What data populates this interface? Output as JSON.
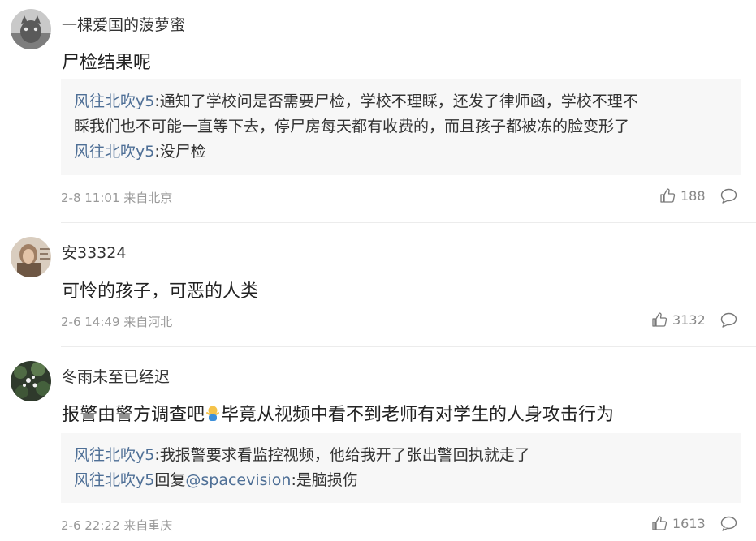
{
  "comments": [
    {
      "username": "一棵爱国的菠萝蜜",
      "content": "尸检结果呢",
      "replies": [
        {
          "user": "风往北吹y5",
          "sep": ":",
          "text": "通知了学校问是否需要尸检，学校不理睬，还发了律师函，学校不理不"
        },
        {
          "user": "",
          "sep": "",
          "text": "睬我们也不可能一直等下去，停尸房每天都有收费的，而且孩子都被冻的脸变形了"
        },
        {
          "user": "风往北吹y5",
          "sep": ":",
          "text": "没尸检"
        }
      ],
      "meta": "2-8 11:01 来自北京",
      "likes": "188"
    },
    {
      "username": "安33324",
      "content": "可怜的孩子，可恶的人类",
      "meta": "2-6 14:49 来自河北",
      "likes": "3132"
    },
    {
      "username": "冬雨未至已经迟",
      "content_before": "报警由警方调查吧",
      "content_after": "毕竟从视频中看不到老师有对学生的人身攻击行为",
      "replies": [
        {
          "user": "风往北吹y5",
          "sep": ":",
          "text": "我报警要求看监控视频，他给我开了张出警回执就走了"
        },
        {
          "user": "风往北吹y5",
          "sep": "回复",
          "mention": "@spacevision",
          "text": ":是脑损伤"
        }
      ],
      "meta": "2-6 22:22 来自重庆",
      "likes": "1613"
    }
  ],
  "icons": {
    "like": "thumbs-up-icon",
    "reply": "comment-bubble-icon",
    "emoji": "person-shrug-emoji"
  },
  "colors": {
    "reply_user": "#4e6f96",
    "meta": "#999999",
    "reply_bg": "#f7f7f7"
  }
}
